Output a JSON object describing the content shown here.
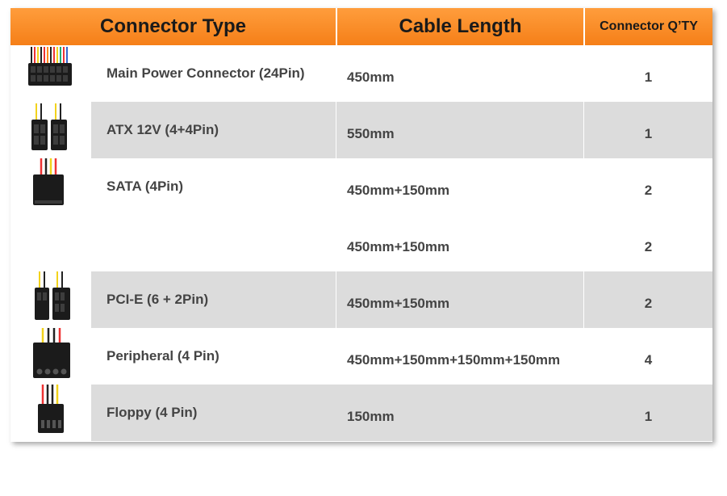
{
  "headers": {
    "connector_type": "Connector Type",
    "cable_length": "Cable Length",
    "connector_qty": "Connector Q’TY"
  },
  "rows": [
    {
      "name": "Main Power Connector (24Pin)",
      "length": "450mm",
      "qty": "1",
      "icon": "24pin-connector-icon",
      "shade": "white"
    },
    {
      "name": "ATX 12V (4+4Pin)",
      "length": "550mm",
      "qty": "1",
      "icon": "atx12v-connector-icon",
      "shade": "gray"
    },
    {
      "name": "SATA (4Pin)",
      "length": "450mm+150mm",
      "qty": "2",
      "icon": "sata-connector-icon",
      "shade": "white"
    },
    {
      "name": "",
      "length": "450mm+150mm",
      "qty": "2",
      "icon": "",
      "shade": "white"
    },
    {
      "name": "PCI-E (6 + 2Pin)",
      "length": "450mm+150mm",
      "qty": "2",
      "icon": "pcie-connector-icon",
      "shade": "gray"
    },
    {
      "name": "Peripheral (4 Pin)",
      "length": "450mm+150mm+150mm+150mm",
      "qty": "4",
      "icon": "molex-connector-icon",
      "shade": "white"
    },
    {
      "name": "Floppy (4 Pin)",
      "length": "150mm",
      "qty": "1",
      "icon": "floppy-connector-icon",
      "shade": "gray"
    }
  ],
  "colors": {
    "header_orange": "#f7851f",
    "row_gray": "#dcdcdc",
    "text": "#444444"
  }
}
